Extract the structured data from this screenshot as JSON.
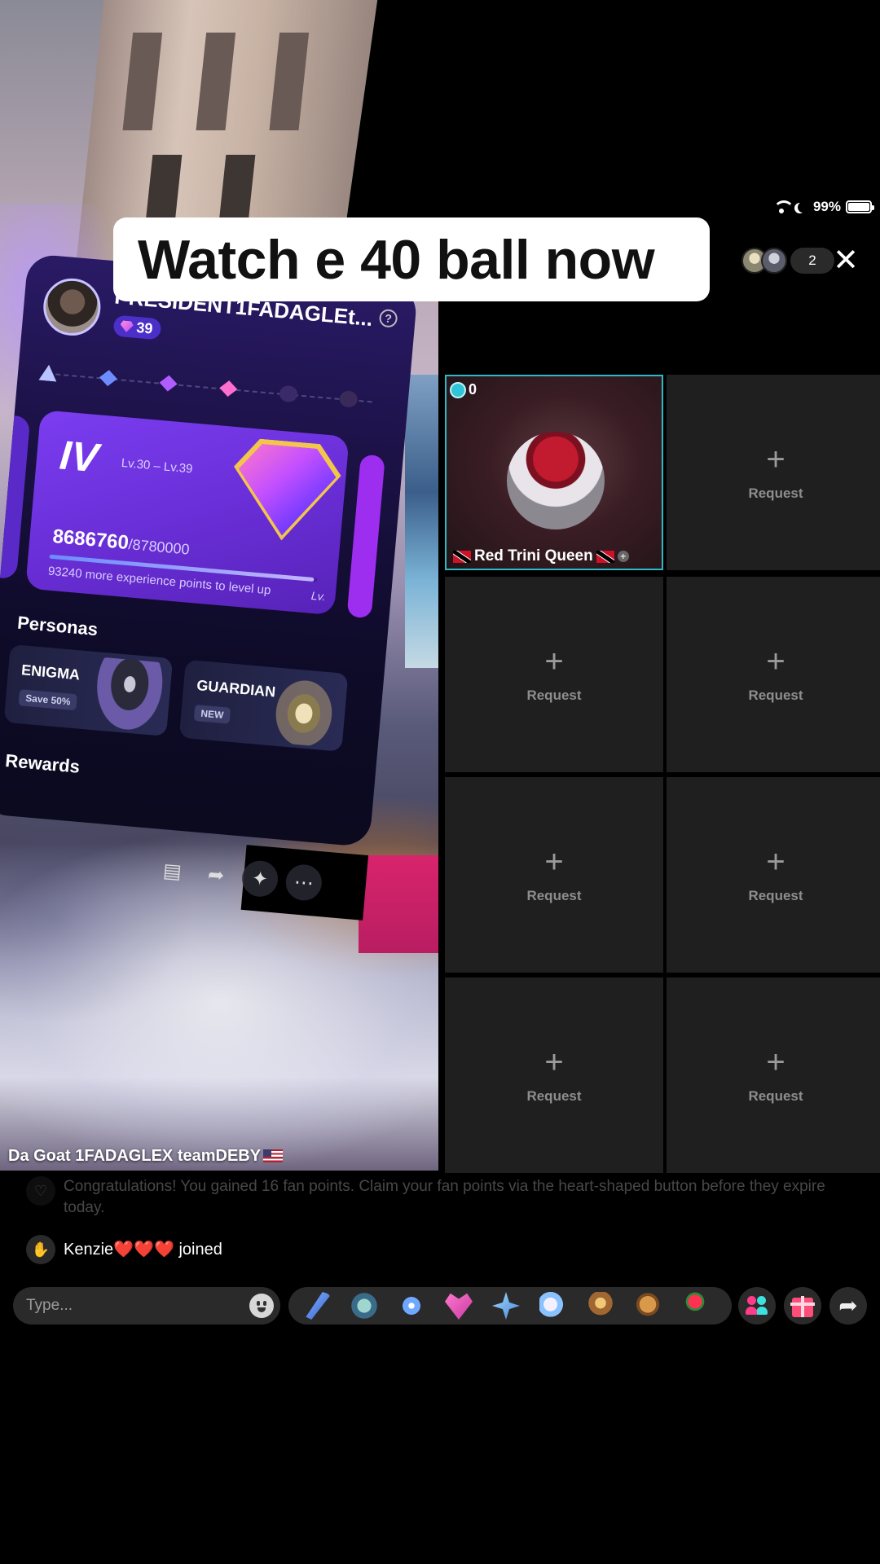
{
  "caption": {
    "text": "Watch e 40 ball now"
  },
  "status_bar": {
    "battery": "99%"
  },
  "viewers": {
    "count": "2"
  },
  "host": {
    "name": "Da Goat 1FADAGLEX teamDEBY"
  },
  "fan_card": {
    "user_name": "PRESIDENT1FADAGLEt...",
    "fan_level": "39",
    "tier": "IV",
    "tier_range": "Lv.30 – Lv.39",
    "points_current": "8686760",
    "points_total": "/8780000",
    "progress_fraction": 0.989,
    "hint": "93240 more experience points to level up",
    "lv_label": "Lv.",
    "personas_title": "Personas",
    "personas": [
      {
        "name": "ENIGMA",
        "tag": "Save 50%"
      },
      {
        "name": "GUARDIAN",
        "tag": "NEW"
      }
    ],
    "rewards_title": "Rewards"
  },
  "guest_grid": {
    "guest": {
      "name": "Red Trini Queen",
      "score": "0"
    },
    "request_label": "Request"
  },
  "comments": {
    "system": "Congratulations! You gained 16 fan points. Claim your fan points via the heart-shaped button before they expire today.",
    "join_user": "Kenzie",
    "join_hearts": "❤️❤️❤️",
    "join_suffix": "joined"
  },
  "input": {
    "placeholder": "Type..."
  },
  "colors": {
    "accent_teal": "#2fb8c6",
    "tier_purple": "#6a2fd8",
    "slot_bg": "#1f1f1f",
    "caption_bg": "#ffffff"
  },
  "icons": [
    "wifi-icon",
    "moon-icon",
    "battery-icon",
    "close-icon",
    "help-icon",
    "emoji-icon",
    "people-icon",
    "gift-icon",
    "share-icon"
  ]
}
